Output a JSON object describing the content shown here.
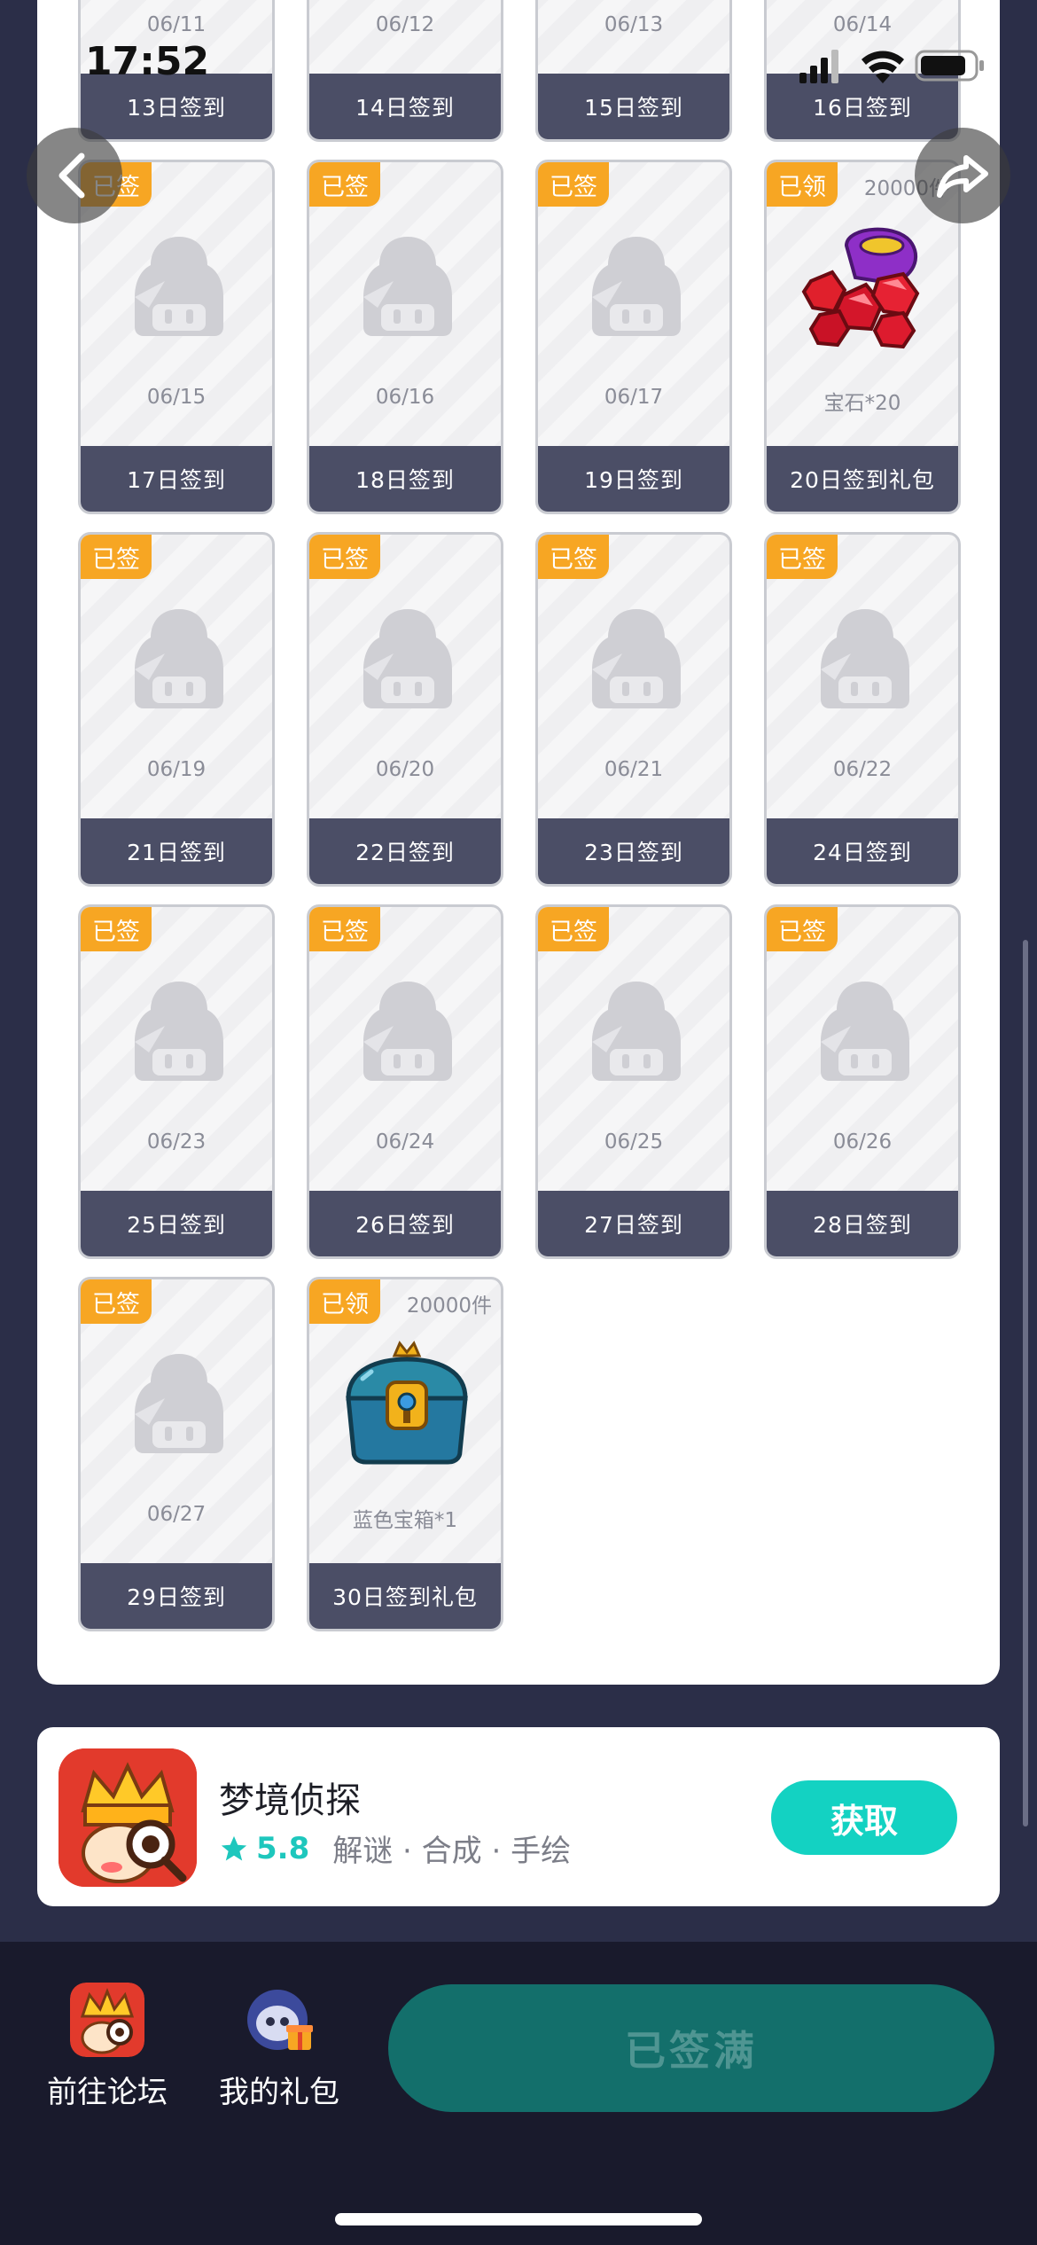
{
  "status_bar": {
    "time": "17:52"
  },
  "nav": {
    "back": "back-icon",
    "share": "share-icon"
  },
  "cards": [
    {
      "label": "13日签到",
      "date": "06/11",
      "badge": "",
      "count": "",
      "prize": ""
    },
    {
      "label": "14日签到",
      "date": "06/12",
      "badge": "",
      "count": "",
      "prize": ""
    },
    {
      "label": "15日签到",
      "date": "06/13",
      "badge": "",
      "count": "",
      "prize": ""
    },
    {
      "label": "16日签到",
      "date": "06/14",
      "badge": "",
      "count": "",
      "prize": ""
    },
    {
      "label": "17日签到",
      "date": "06/15",
      "badge": "已签",
      "count": "",
      "prize": ""
    },
    {
      "label": "18日签到",
      "date": "06/16",
      "badge": "已签",
      "count": "",
      "prize": ""
    },
    {
      "label": "19日签到",
      "date": "06/17",
      "badge": "已签",
      "count": "",
      "prize": ""
    },
    {
      "label": "20日签到礼包",
      "date": "宝石*20",
      "badge": "已领",
      "count": "20000件",
      "prize": "gem"
    },
    {
      "label": "21日签到",
      "date": "06/19",
      "badge": "已签",
      "count": "",
      "prize": ""
    },
    {
      "label": "22日签到",
      "date": "06/20",
      "badge": "已签",
      "count": "",
      "prize": ""
    },
    {
      "label": "23日签到",
      "date": "06/21",
      "badge": "已签",
      "count": "",
      "prize": ""
    },
    {
      "label": "24日签到",
      "date": "06/22",
      "badge": "已签",
      "count": "",
      "prize": ""
    },
    {
      "label": "25日签到",
      "date": "06/23",
      "badge": "已签",
      "count": "",
      "prize": ""
    },
    {
      "label": "26日签到",
      "date": "06/24",
      "badge": "已签",
      "count": "",
      "prize": ""
    },
    {
      "label": "27日签到",
      "date": "06/25",
      "badge": "已签",
      "count": "",
      "prize": ""
    },
    {
      "label": "28日签到",
      "date": "06/26",
      "badge": "已签",
      "count": "",
      "prize": ""
    },
    {
      "label": "29日签到",
      "date": "06/27",
      "badge": "已签",
      "count": "",
      "prize": ""
    },
    {
      "label": "30日签到礼包",
      "date": "蓝色宝箱*1",
      "badge": "已领",
      "count": "20000件",
      "prize": "chest"
    }
  ],
  "promo": {
    "app_name": "梦境侦探",
    "rating": "5.8",
    "tags": "解谜 · 合成 · 手绘",
    "get_label": "获取"
  },
  "bottom_bar": {
    "forum_label": "前往论坛",
    "gifts_label": "我的礼包",
    "signed_full_label": "已签满"
  },
  "colors": {
    "badge": "#f7a623",
    "card_footer": "#4b4e66",
    "get_button": "#13d2c2",
    "signed_full_button": "#136f6b"
  }
}
